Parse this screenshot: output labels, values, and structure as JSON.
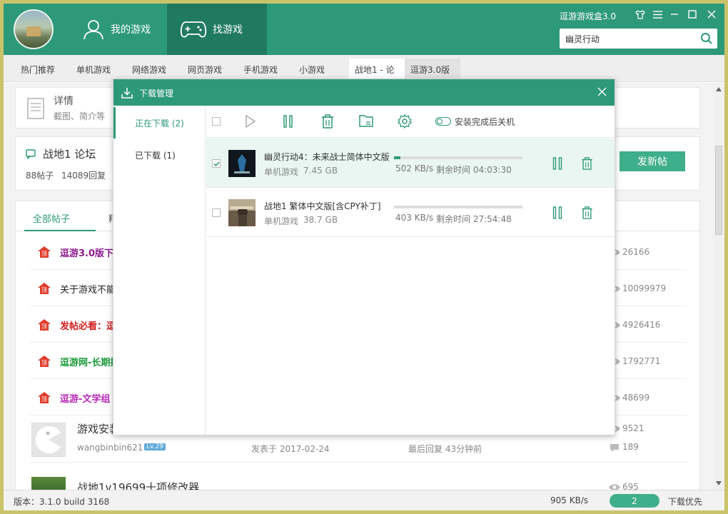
{
  "header": {
    "nav": [
      {
        "label": "我的游戏"
      },
      {
        "label": "找游戏"
      }
    ],
    "app_title": "逗游游戏盒3.0",
    "search": {
      "value": "幽灵行动",
      "placeholder": ""
    }
  },
  "categories": [
    "热门推荐",
    "单机游戏",
    "网络游戏",
    "网页游戏",
    "手机游戏",
    "小游戏",
    "战地1 - 论",
    "逗游3.0版"
  ],
  "detail": {
    "title": "详情",
    "subtitle": "截图、简介等"
  },
  "forum": {
    "title": "战地1 论坛",
    "posts": "88帖子",
    "replies": "14089回复",
    "new_post": "发新帖"
  },
  "post_tabs": [
    "全部帖子",
    "精"
  ],
  "posts": [
    {
      "title": "逗游3.0版下载",
      "color": "#8b1a8b",
      "views": "26166"
    },
    {
      "title": "关于游戏不能",
      "color": "#222222",
      "views": "10099979"
    },
    {
      "title": "发帖必看：逗",
      "color": "#d42020",
      "views": "4926416"
    },
    {
      "title": "逗游网-长期招",
      "color": "#1a9a3a",
      "views": "1792771"
    },
    {
      "title": "逗游-文学组",
      "color": "#b82ab8",
      "views": "48699"
    }
  ],
  "normal_posts": [
    {
      "title": "游戏安装",
      "author": "wangbinbin621",
      "level": "Lv.29",
      "date": "发表于 2017-02-24",
      "last_reply": "最后回复 43分钟前",
      "views": "9521",
      "replies": "189"
    },
    {
      "title": "战地1v19699十项修改器",
      "views": "695"
    }
  ],
  "statusbar": {
    "version": "版本：3.1.0 build 3168",
    "speed": "905 KB/s",
    "count": "2",
    "mode": "下载优先"
  },
  "dialog": {
    "title": "下载管理",
    "sidebar": [
      {
        "label": "正在下载 (2)"
      },
      {
        "label": "已下载 (1)"
      }
    ],
    "toolbar": {
      "shutdown_label": "安装完成后关机"
    },
    "downloads": [
      {
        "name": "幽灵行动4：未来战士简体中文版",
        "category": "单机游戏",
        "size": "7.45 GB",
        "speed": "502 KB/s",
        "remaining": "剩余时间 04:03:30",
        "progress": 0.05,
        "checked": true
      },
      {
        "name": "战地1  繁体中文版[含CPY补丁]",
        "category": "单机游戏",
        "size": "38.7 GB",
        "speed": "403 KB/s",
        "remaining": "剩余时间 27:54:48",
        "progress": 0.0,
        "checked": false
      }
    ]
  },
  "colors": {
    "accent": "#2e9979",
    "accent_dark": "#207a5f"
  }
}
